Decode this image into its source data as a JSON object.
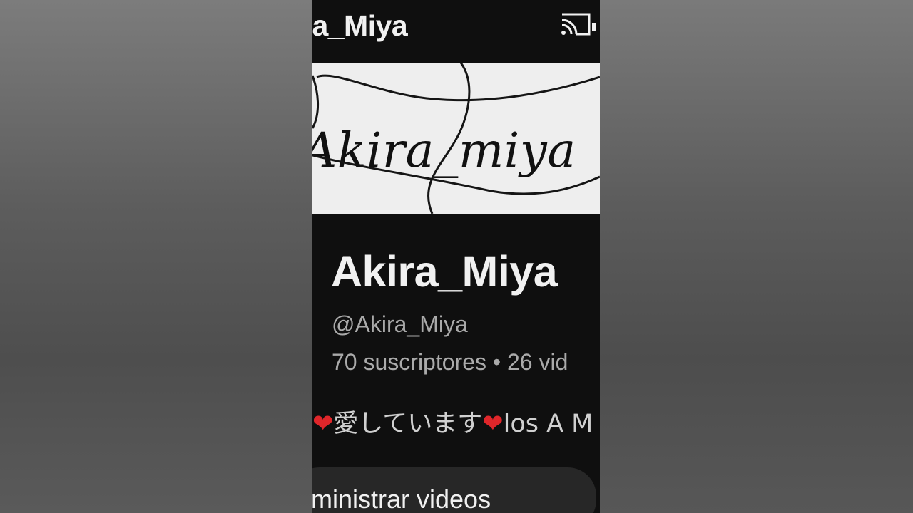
{
  "header": {
    "title": "ra_Miya",
    "cast_icon": "cast-icon"
  },
  "banner": {
    "text": "Akira_miya"
  },
  "channel": {
    "name": "Akira_Miya",
    "handle": "@Akira_Miya",
    "subscribers": "70 suscriptores",
    "separator": "•",
    "videos": "26 vid"
  },
  "description": {
    "heart_icon": "heart-icon",
    "heart": "❤",
    "text_jp": "愛しています",
    "text_es": "los A M"
  },
  "actions": {
    "manage_videos_label": "ministrar videos"
  },
  "colors": {
    "background": "#0f0f0f",
    "text_primary": "#f1f1f1",
    "text_secondary": "#aaaaaa",
    "button_bg": "#272727",
    "heart": "#e0262a",
    "banner_bg": "#eeeeee"
  }
}
